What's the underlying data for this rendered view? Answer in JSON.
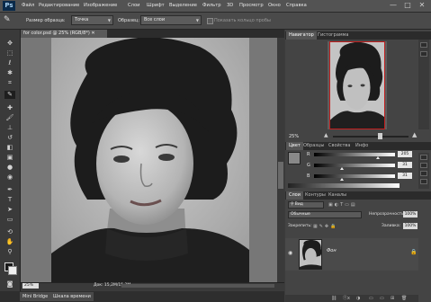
{
  "app": {
    "logo": "Ps"
  },
  "menu": [
    "Файл",
    "Редактирование",
    "Изображение",
    "Слои",
    "Шрифт",
    "Выделение",
    "Фильтр",
    "3D",
    "Просмотр",
    "Окно",
    "Справка"
  ],
  "window_controls": {
    "minimize": "—",
    "maximize": "□",
    "close": "✕"
  },
  "options": {
    "sample_size_label": "Размер образца:",
    "sample_size_value": "Точка",
    "sample_label": "Образец:",
    "sample_value": "Все слои",
    "ring_label": "Показать кольцо пробы"
  },
  "document": {
    "tab_title": "for color.psd @ 25% (RGB/8*)",
    "zoom": "25%",
    "doc_info": "Док: 15,2M/15,2M"
  },
  "bottom_tabs": [
    "Mini Bridge",
    "Шкала времени"
  ],
  "navigator": {
    "tabs": [
      "Навигатор",
      "Гистограмма"
    ],
    "zoom": "25%"
  },
  "color_panel": {
    "tabs": [
      "Цвет",
      "Образцы",
      "Свойства",
      "Инфо"
    ],
    "rows": [
      {
        "label": "R",
        "value": "205"
      },
      {
        "label": "G",
        "value": "31"
      },
      {
        "label": "B",
        "value": "31"
      }
    ]
  },
  "layers_panel": {
    "tabs": [
      "Слои",
      "Контуры",
      "Каналы"
    ],
    "kind_filter": "Вид",
    "blend_mode": "Обычные",
    "opacity_label": "Непрозрачность:",
    "opacity_value": "100%",
    "lock_label": "Закрепить:",
    "fill_label": "Заливка:",
    "fill_value": "100%",
    "layer_name": "Фон",
    "bottom_icons": [
      "ⓕx",
      "◑",
      "▭",
      "▭",
      "⊞",
      "🗑"
    ]
  },
  "colors": {
    "accent_red": "#c21f1f",
    "photo_bg": "#b8b8b8"
  }
}
